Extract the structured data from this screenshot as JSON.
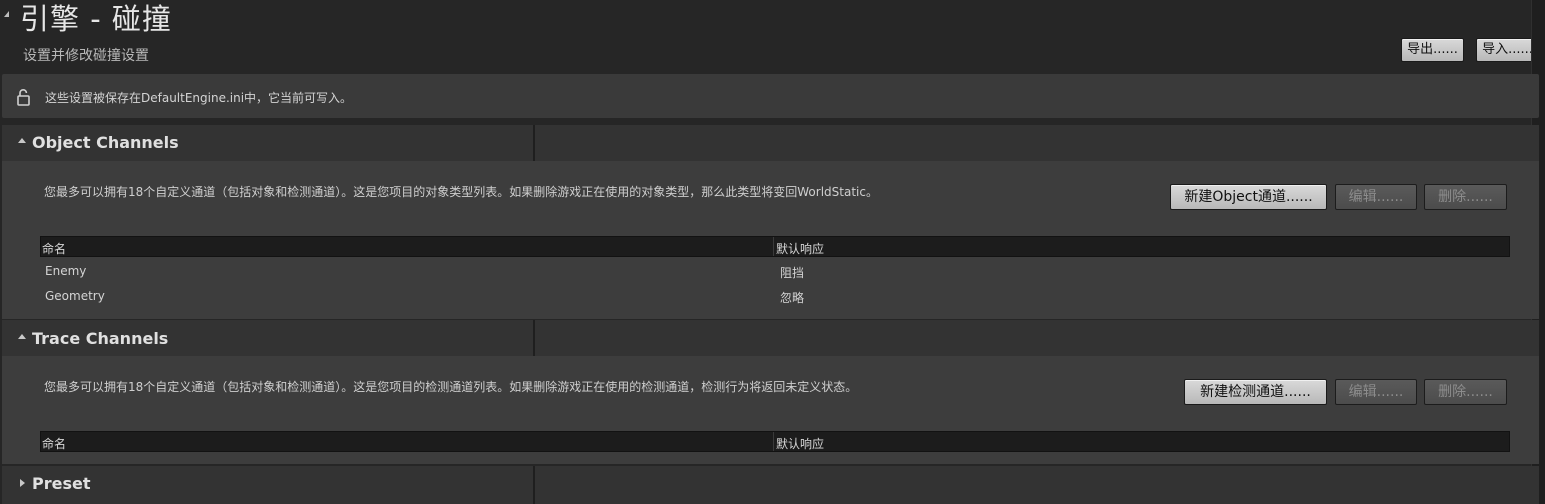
{
  "header": {
    "title": "引擎 - 碰撞",
    "subtitle": "设置并修改碰撞设置",
    "export_label": "导出......",
    "import_label": "导入......"
  },
  "info_bar": {
    "text": "这些设置被保存在DefaultEngine.ini中，它当前可写入。",
    "icon": "unlocked-lock-icon"
  },
  "object_channels": {
    "title": "Object Channels",
    "expanded": true,
    "description": "您最多可以拥有18个自定义通道（包括对象和检测通道）。这是您项目的对象类型列表。如果删除游戏正在使用的对象类型，那么此类型将变回WorldStatic。",
    "new_label": "新建Object通道......",
    "edit_label": "编辑......",
    "delete_label": "删除......",
    "columns": [
      "命名",
      "默认响应"
    ],
    "rows": [
      {
        "name": "Enemy",
        "response": "阻挡"
      },
      {
        "name": "Geometry",
        "response": "忽略"
      }
    ]
  },
  "trace_channels": {
    "title": "Trace Channels",
    "expanded": true,
    "description": "您最多可以拥有18个自定义通道（包括对象和检测通道）。这是您项目的检测通道列表。如果删除游戏正在使用的检测通道，检测行为将返回未定义状态。",
    "new_label": "新建检测通道......",
    "edit_label": "编辑......",
    "delete_label": "删除......",
    "columns": [
      "命名",
      "默认响应"
    ]
  },
  "preset": {
    "title": "Preset",
    "expanded": false
  },
  "colors": {
    "background": "#262626",
    "section_header": "#333333",
    "section_body": "#3d3d3d",
    "button": "#c8c8c8",
    "button_disabled": "#525252"
  }
}
